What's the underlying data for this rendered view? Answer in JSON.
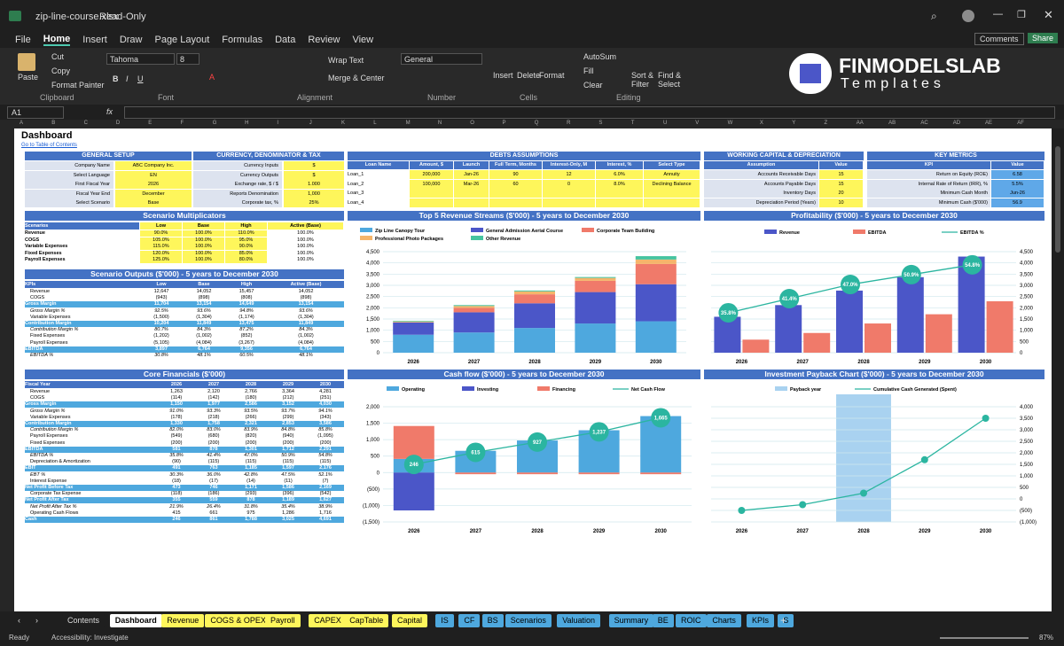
{
  "app": {
    "file_title": "zip-line-course.xlsx",
    "mode": "Read-Only",
    "comments": "Comments",
    "share": "Share"
  },
  "menu": [
    "File",
    "Home",
    "Insert",
    "Draw",
    "Page Layout",
    "Formulas",
    "Data",
    "Review",
    "View"
  ],
  "ribbon": {
    "paste": "Paste",
    "cut": "Cut",
    "copy": "Copy",
    "format_painter": "Format Painter",
    "clipboard": "Clipboard",
    "font_name": "Tahoma",
    "font_size": "8",
    "font": "Font",
    "wrap_text": "Wrap Text",
    "merge_center": "Merge & Center",
    "alignment": "Alignment",
    "number_format": "General",
    "number": "Number",
    "insert": "Insert",
    "delete": "Delete",
    "format": "Format",
    "cells": "Cells",
    "autosum": "AutoSum",
    "fill": "Fill",
    "clear": "Clear",
    "sort_filter": "Sort & Filter",
    "find_select": "Find & Select",
    "editing": "Editing",
    "brand_name": "FINMODELSLAB",
    "brand_sub": "Templates"
  },
  "formula_bar": {
    "cell_ref": "A1",
    "fx": "fx"
  },
  "columns": [
    "A",
    "B",
    "C",
    "D",
    "E",
    "F",
    "G",
    "H",
    "I",
    "J",
    "K",
    "L",
    "M",
    "N",
    "O",
    "P",
    "Q",
    "R",
    "S",
    "T",
    "U",
    "V",
    "W",
    "X",
    "Y",
    "Z",
    "AA",
    "AB",
    "AC",
    "AD",
    "AE",
    "AF"
  ],
  "sheet": {
    "title": "Dashboard",
    "toc_link": "Go to Table of Contents",
    "general": {
      "header": "GENERAL SETUP",
      "rows": [
        [
          "Company Name",
          "ABC Company Inc."
        ],
        [
          "Select Language",
          "EN"
        ],
        [
          "First Fiscal Year",
          "2026"
        ],
        [
          "Fiscal Year End",
          "December"
        ],
        [
          "Select Scenario",
          "Base"
        ]
      ]
    },
    "currency": {
      "header": "CURRENCY, DENOMINATOR & TAX",
      "rows": [
        [
          "Currency Inputs",
          "$"
        ],
        [
          "Currency Outputs",
          "$"
        ],
        [
          "Exchange rate, $ / $",
          "1.000"
        ],
        [
          "Reports Denomination",
          "1,000"
        ],
        [
          "Corporate tax, %",
          "25%"
        ]
      ]
    },
    "debts": {
      "header": "DEBTS ASSUMPTIONS",
      "cols": [
        "Loan Name",
        "Amount, $",
        "Launch",
        "Full Term, Months",
        "Interest-Only, M",
        "Interest, %",
        "Select Type"
      ],
      "rows": [
        [
          "Loan_1",
          "200,000",
          "Jan-26",
          "90",
          "12",
          "6.0%",
          "Annuity"
        ],
        [
          "Loan_2",
          "100,000",
          "Mar-26",
          "60",
          "0",
          "8.0%",
          "Declining Balance"
        ],
        [
          "Loan_3",
          "",
          "",
          "",
          "",
          "",
          ""
        ],
        [
          "Loan_4",
          "",
          "",
          "",
          "",
          "",
          ""
        ]
      ]
    },
    "wc": {
      "header": "WORKING CAPITAL & DEPRECIATION",
      "cols": [
        "Assumption",
        "Value"
      ],
      "rows": [
        [
          "Accounts Receivable Days",
          "15"
        ],
        [
          "Accounts Payable Days",
          "15"
        ],
        [
          "Inventory Days",
          "20"
        ],
        [
          "Depreciation Period (Years)",
          "10"
        ]
      ]
    },
    "kpi": {
      "header": "KEY METRICS",
      "cols": [
        "KPI",
        "Value"
      ],
      "rows": [
        [
          "Return on Equity (ROE)",
          "6.58"
        ],
        [
          "Internal Rate of Return (IRR), %",
          "5.5%"
        ],
        [
          "Minimum Cash Month",
          "Jun-26"
        ],
        [
          "Minimum Cash ($'000)",
          "56.9"
        ]
      ]
    },
    "multipliers": {
      "title": "Scenario Multiplicators",
      "cols": [
        "Scenarios",
        "Low",
        "Base",
        "High",
        "Active (Base)"
      ],
      "rows": [
        [
          "Revenue",
          "90.0%",
          "100.0%",
          "110.0%",
          "100.0%"
        ],
        [
          "COGS",
          "105.0%",
          "100.0%",
          "95.0%",
          "100.0%"
        ],
        [
          "Variable Expenses",
          "115.0%",
          "100.0%",
          "90.0%",
          "100.0%"
        ],
        [
          "Fixed Expenses",
          "120.0%",
          "100.0%",
          "85.0%",
          "100.0%"
        ],
        [
          "Payroll Expenses",
          "125.0%",
          "100.0%",
          "80.0%",
          "100.0%"
        ]
      ]
    },
    "outputs": {
      "title": "Scenario Outputs ($'000) - 5 years to December 2030",
      "cols": [
        "KPIs",
        "Low",
        "Base",
        "High",
        "Active (Base)"
      ],
      "rows": [
        [
          "Revenue",
          "12,647",
          "14,052",
          "15,457",
          "14,052"
        ],
        [
          "COGS",
          "(943)",
          "(898)",
          "(808)",
          "(898)"
        ],
        [
          "Gross Margin",
          "11,704",
          "13,154",
          "14,649",
          "13,154"
        ],
        [
          "Gross Margin %",
          "92.5%",
          "93.6%",
          "94.8%",
          "93.6%"
        ],
        [
          "Variable Expenses",
          "(1,500)",
          "(1,304)",
          "(1,174)",
          "(1,304)"
        ],
        [
          "Contribution Margin",
          "10,204",
          "11,849",
          "13,475",
          "11,849"
        ],
        [
          "Contribution Margin %",
          "80.7%",
          "84.3%",
          "87.2%",
          "84.3%"
        ],
        [
          "Fixed Expenses",
          "(1,202)",
          "(1,002)",
          "(852)",
          "(1,002)"
        ],
        [
          "Payroll Expenses",
          "(5,105)",
          "(4,084)",
          "(3,267)",
          "(4,084)"
        ],
        [
          "EBITDA",
          "3,897",
          "6,764",
          "9,356",
          "6,764"
        ],
        [
          "EBITDA %",
          "30.8%",
          "48.1%",
          "60.5%",
          "48.1%"
        ]
      ]
    },
    "core": {
      "title": "Core Financials ($'000)",
      "cols": [
        "Fiscal Year",
        "2026",
        "2027",
        "2028",
        "2029",
        "2030"
      ],
      "rows": [
        [
          "Revenue",
          "1,263",
          "2,120",
          "2,766",
          "3,364",
          "4,281"
        ],
        [
          "COGS",
          "(114)",
          "(142)",
          "(180)",
          "(212)",
          "(251)"
        ],
        [
          "Gross Margin",
          "1,150",
          "1,977",
          "2,586",
          "3,152",
          "4,030"
        ],
        [
          "Gross Margin %",
          "91.0%",
          "93.3%",
          "93.5%",
          "93.7%",
          "94.1%"
        ],
        [
          "Variable Expenses",
          "(178)",
          "(218)",
          "(266)",
          "(299)",
          "(343)"
        ],
        [
          "Contribution Margin",
          "1,330",
          "1,758",
          "2,321",
          "2,853",
          "3,586"
        ],
        [
          "Contribution Margin %",
          "82.0%",
          "83.0%",
          "83.9%",
          "84.8%",
          "85.8%"
        ],
        [
          "Payroll Expenses",
          "(549)",
          "(680)",
          "(820)",
          "(940)",
          "(1,095)"
        ],
        [
          "Fixed Expenses",
          "(200)",
          "(200)",
          "(200)",
          "(200)",
          "(200)"
        ],
        [
          "EBITDA",
          "581",
          "878",
          "1,301",
          "1,712",
          "2,291"
        ],
        [
          "EBITDA %",
          "35.8%",
          "41.4%",
          "47.0%",
          "50.9%",
          "54.8%"
        ],
        [
          "Depreciation & Amortization",
          "(90)",
          "(115)",
          "(115)",
          "(115)",
          "(115)"
        ],
        [
          "EBIT",
          "491",
          "763",
          "1,185",
          "1,597",
          "2,176"
        ],
        [
          "EBT %",
          "30.3%",
          "36.0%",
          "42.8%",
          "47.5%",
          "52.1%"
        ],
        [
          "Interest Expense",
          "(18)",
          "(17)",
          "(14)",
          "(11)",
          "(7)"
        ],
        [
          "Net Profit Before Tax",
          "473",
          "746",
          "1,171",
          "1,586",
          "2,169"
        ],
        [
          "Corporate Tax Expense",
          "(118)",
          "(186)",
          "(293)",
          "(396)",
          "(542)"
        ],
        [
          "Net Profit After Tax",
          "355",
          "559",
          "878",
          "1,189",
          "1,627"
        ],
        [
          "Net Profit After Tax %",
          "21.9%",
          "26.4%",
          "31.8%",
          "35.4%",
          "38.9%"
        ],
        [
          "Operating Cash Flows",
          "415",
          "661",
          "975",
          "1,286",
          "1,716"
        ],
        [
          "Cash",
          "246",
          "861",
          "1,788",
          "3,025",
          "4,691"
        ]
      ]
    }
  },
  "chart_data": [
    {
      "type": "bar",
      "title": "Top 5 Revenue Streams ($'000) - 5 years to December 2030",
      "categories": [
        "2026",
        "2027",
        "2028",
        "2029",
        "2030"
      ],
      "ylim": [
        0,
        4500
      ],
      "series": [
        {
          "name": "Zip Line Canopy Tour",
          "values": [
            800,
            900,
            1100,
            1300,
            1400
          ],
          "color": "#4ea8de"
        },
        {
          "name": "General Admission Aerial Course",
          "values": [
            550,
            900,
            1100,
            1400,
            1650
          ],
          "color": "#4b56c8"
        },
        {
          "name": "Corporate Team Building",
          "values": [
            0,
            200,
            400,
            500,
            900
          ],
          "color": "#f07a6a"
        },
        {
          "name": "Professional Photo Packages",
          "values": [
            40,
            80,
            130,
            130,
            200
          ],
          "color": "#f5b56b"
        },
        {
          "name": "Other Revenue",
          "values": [
            30,
            40,
            40,
            40,
            150
          ],
          "color": "#45c4a0"
        }
      ]
    },
    {
      "type": "bar",
      "title": "Profitability ($'000) - 5 years to December 2030",
      "categories": [
        "2026",
        "2027",
        "2028",
        "2029",
        "2030"
      ],
      "ylim": [
        0,
        4500
      ],
      "series": [
        {
          "name": "Revenue",
          "values": [
            1600,
            2120,
            2766,
            3364,
            4281
          ],
          "color": "#4b56c8"
        },
        {
          "name": "EBITDA",
          "values": [
            581,
            878,
            1301,
            1712,
            2291
          ],
          "color": "#f07a6a"
        },
        {
          "name": "EBITDA %",
          "values": [
            35.8,
            41.4,
            47.0,
            50.9,
            54.8
          ],
          "color": "#2bb5a0"
        }
      ]
    },
    {
      "type": "bar",
      "title": "Cash flow ($'000) - 5 years to December 2030",
      "categories": [
        "2026",
        "2027",
        "2028",
        "2029",
        "2030"
      ],
      "ylim": [
        -1500,
        2000
      ],
      "series": [
        {
          "name": "Operating",
          "values": [
            415,
            661,
            975,
            1286,
            1716
          ],
          "color": "#4ea8de"
        },
        {
          "name": "Investing",
          "values": [
            -1150,
            0,
            0,
            0,
            0
          ],
          "color": "#4b56c8"
        },
        {
          "name": "Financing",
          "values": [
            1000,
            -50,
            -50,
            -50,
            -50
          ],
          "color": "#f07a6a"
        },
        {
          "name": "Net Cash Flow",
          "values": [
            246,
            615,
            927,
            1237,
            1665
          ],
          "color": "#2bb5a0"
        }
      ]
    },
    {
      "type": "line",
      "title": "Investment Payback Chart ($'000) - 5 years to December 2030",
      "categories": [
        "2026",
        "2027",
        "2028",
        "2029",
        "2030"
      ],
      "ylim": [
        -1000,
        4000
      ],
      "series": [
        {
          "name": "Payback year",
          "values": [
            0,
            0,
            1,
            0,
            0
          ],
          "color": "#a9d2f0"
        },
        {
          "name": "Cumulative Cash Generated (Spent)",
          "values": [
            -500,
            -250,
            250,
            1700,
            3500
          ],
          "color": "#2bb5a0"
        }
      ]
    }
  ],
  "tabs": [
    "Contents",
    "Dashboard",
    "Revenue",
    "COGS & OPEX",
    "Payroll",
    "CAPEX",
    "CapTable",
    "Capital",
    "IS",
    "CF",
    "BS",
    "Scenarios",
    "Valuation",
    "Summary",
    "BE",
    "ROIC",
    "Charts",
    "KPIs",
    "S"
  ],
  "status": {
    "ready": "Ready",
    "accessibility": "Accessibility: Investigate",
    "zoom": "87%"
  }
}
